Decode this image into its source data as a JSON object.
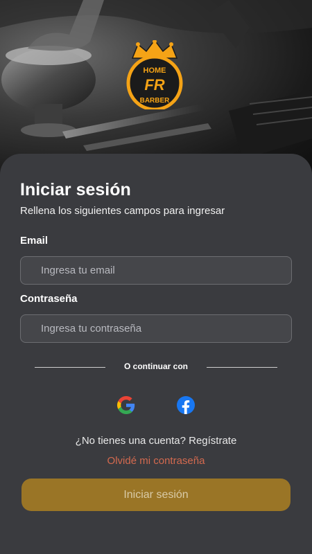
{
  "brand": {
    "logo_top": "HOME",
    "logo_mid": "FR",
    "logo_bottom": "BARBER"
  },
  "login": {
    "title": "Iniciar sesión",
    "subtitle": "Rellena los siguientes campos para ingresar",
    "email_label": "Email",
    "email_placeholder": "Ingresa tu email",
    "email_value": "",
    "password_label": "Contraseña",
    "password_placeholder": "Ingresa tu contraseña",
    "password_value": "",
    "or_text": "O continuar con",
    "social": [
      "google-icon",
      "facebook-icon"
    ],
    "register_text": "¿No tienes una cuenta? Regístrate",
    "forgot_text": "Olvidé mi contraseña",
    "submit_label": "Iniciar sesión"
  },
  "colors": {
    "background": "#3a3b3f",
    "accent": "#9a7526",
    "forgot": "#d46a4f",
    "logo_orange": "#f5a316"
  }
}
